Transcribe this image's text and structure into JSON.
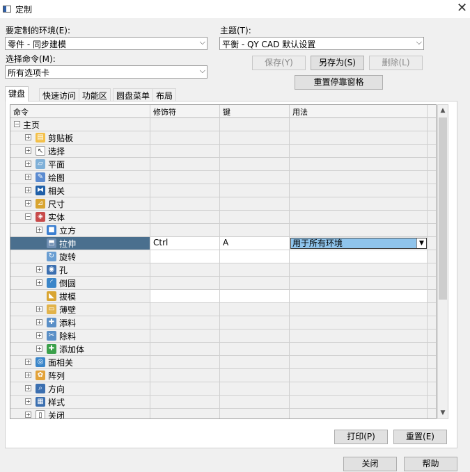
{
  "window": {
    "title": "定制"
  },
  "env": {
    "label": "要定制的环境(E):",
    "value": "零件 - 同步建模"
  },
  "command": {
    "label": "选择命令(M):",
    "value": "所有选项卡"
  },
  "theme": {
    "label": "主题(T):",
    "value": "平衡 - QY CAD 默认设置"
  },
  "buttons": {
    "save": "保存(Y)",
    "save_as": "另存为(S)",
    "delete": "删除(L)",
    "reset_dock": "重置停靠窗格",
    "print": "打印(P)",
    "reset": "重置(E)",
    "close": "关闭",
    "help": "帮助"
  },
  "tabs": [
    "键盘",
    "快速访问",
    "功能区",
    "圆盘菜单",
    "布局"
  ],
  "grid": {
    "headers": [
      "命令",
      "修饰符",
      "键",
      "用法"
    ],
    "rows": [
      {
        "label": "主页",
        "level": 0,
        "exp": "−",
        "icon": ""
      },
      {
        "label": "剪贴板",
        "level": 1,
        "exp": "+",
        "icon": "clipboard-icon"
      },
      {
        "label": "选择",
        "level": 1,
        "exp": "+",
        "icon": "cursor-icon"
      },
      {
        "label": "平面",
        "level": 1,
        "exp": "+",
        "icon": "plane-icon"
      },
      {
        "label": "绘图",
        "level": 1,
        "exp": "+",
        "icon": "sketch-icon"
      },
      {
        "label": "相关",
        "level": 1,
        "exp": "+",
        "icon": "relate-icon"
      },
      {
        "label": "尺寸",
        "level": 1,
        "exp": "+",
        "icon": "dimension-icon"
      },
      {
        "label": "实体",
        "level": 1,
        "exp": "−",
        "icon": "solid-icon"
      },
      {
        "label": "立方",
        "level": 2,
        "exp": "+",
        "icon": "cube-icon"
      },
      {
        "label": "拉伸",
        "level": 2,
        "exp": "",
        "icon": "extrude-icon",
        "modifier": "Ctrl",
        "key": "A",
        "usage": "用于所有环境",
        "selected": true
      },
      {
        "label": "旋转",
        "level": 2,
        "exp": "",
        "icon": "revolve-icon",
        "white": true
      },
      {
        "label": "孔",
        "level": 2,
        "exp": "+",
        "icon": "hole-icon"
      },
      {
        "label": "倒圆",
        "level": 2,
        "exp": "+",
        "icon": "round-icon"
      },
      {
        "label": "拔模",
        "level": 2,
        "exp": "",
        "icon": "draft-icon",
        "white": true
      },
      {
        "label": "薄壁",
        "level": 2,
        "exp": "+",
        "icon": "thinwall-icon"
      },
      {
        "label": "添料",
        "level": 2,
        "exp": "+",
        "icon": "add-material-icon"
      },
      {
        "label": "除料",
        "level": 2,
        "exp": "+",
        "icon": "remove-material-icon"
      },
      {
        "label": "添加体",
        "level": 2,
        "exp": "+",
        "icon": "add-body-icon"
      },
      {
        "label": "面相关",
        "level": 1,
        "exp": "+",
        "icon": "face-relate-icon"
      },
      {
        "label": "阵列",
        "level": 1,
        "exp": "+",
        "icon": "pattern-icon"
      },
      {
        "label": "方向",
        "level": 1,
        "exp": "+",
        "icon": "orient-icon"
      },
      {
        "label": "样式",
        "level": 1,
        "exp": "+",
        "icon": "style-icon"
      },
      {
        "label": "关闭",
        "level": 1,
        "exp": "+",
        "icon": "close-doc-icon"
      }
    ]
  },
  "colors": {
    "selected_row": "#4a6f8e",
    "usage_highlight": "#8fc4ec"
  }
}
